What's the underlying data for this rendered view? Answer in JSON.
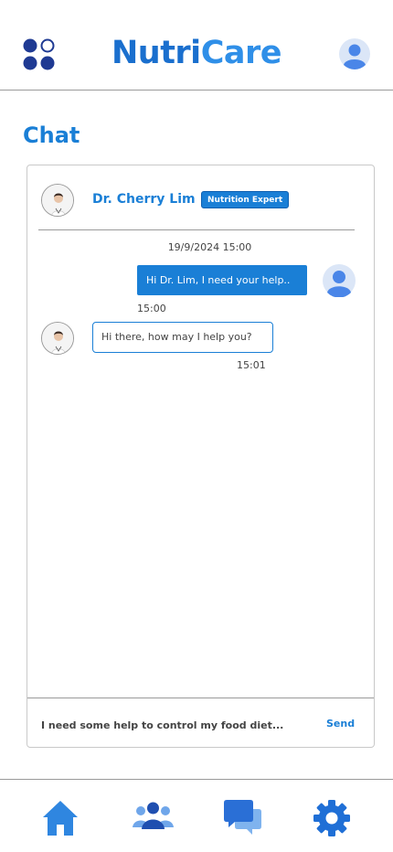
{
  "app": {
    "brand_part1": "Nutri",
    "brand_part2": "Care"
  },
  "page": {
    "title": "Chat"
  },
  "chat": {
    "doctor_name": "Dr. Cherry Lim",
    "doctor_badge": "Nutrition Expert",
    "date_stamp": "19/9/2024 15:00",
    "messages": [
      {
        "from": "user",
        "text": "Hi Dr. Lim, I need your help..",
        "time": "15:00"
      },
      {
        "from": "doctor",
        "text": "Hi there, how may I help you?",
        "time": "15:01"
      }
    ],
    "input_value": "I need some help to control my food diet...",
    "send_label": "Send"
  },
  "nav": {
    "items": [
      "home-icon",
      "community-icon",
      "chat-icon",
      "settings-icon"
    ]
  },
  "colors": {
    "primary": "#1a7fd6",
    "brand_dark": "#1a6fce",
    "brand_light": "#2f8fe8",
    "menu_icon": "#1f3a93",
    "avatar_bg": "#dbe6f7",
    "avatar_fg": "#4a86e8"
  }
}
